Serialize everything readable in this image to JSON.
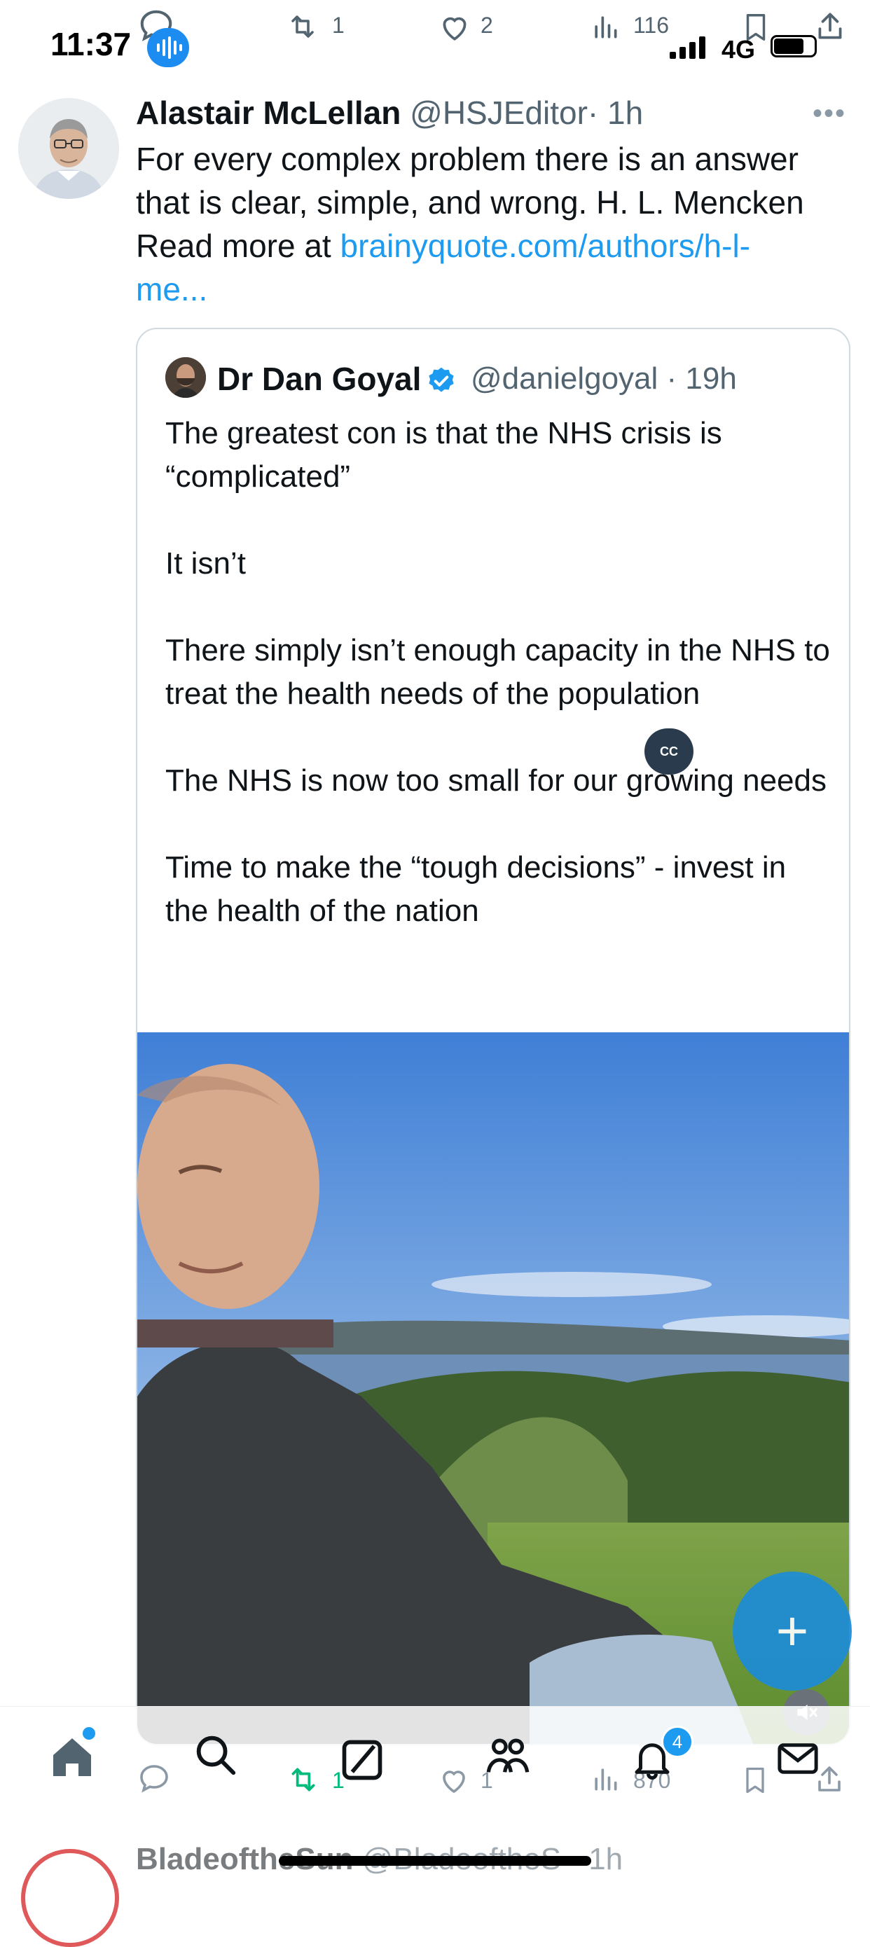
{
  "status_bar": {
    "time": "11:37",
    "network": "4G",
    "icons": [
      "mic-wave-icon",
      "signal-icon",
      "battery-icon"
    ]
  },
  "top_actions": {
    "retweets": "1",
    "likes": "2",
    "views": "116"
  },
  "tweet": {
    "author_name": "Alastair McLellan",
    "handle": "@HSJEditor",
    "time": "· 1h",
    "text": "For every complex problem there is an answer that is clear, simple, and wrong. H. L. Mencken",
    "link_prefix": "Read more at ",
    "link_line1": "brainyquote.com/authors/h-l-",
    "link_line2": "me..."
  },
  "quote": {
    "author_name": "Dr Dan Goyal",
    "handle": "@danielgoyal · 19h",
    "paragraphs": [
      "The greatest con is that the NHS crisis is “complicated”",
      "It isn’t",
      "There simply isn’t enough capacity in the NHS to treat the health needs of the population",
      "The NHS is now too small for our growing needs",
      "Time to make the “tough decisions” - invest in the health of the nation"
    ],
    "cc_label": "CC"
  },
  "bottom_actions": {
    "retweets": "1",
    "likes": "1",
    "views": "870"
  },
  "nav": {
    "notifications_badge": "4",
    "tabs": [
      "home-icon",
      "search-icon",
      "grok-icon",
      "communities-icon",
      "notifications-icon",
      "messages-icon"
    ]
  },
  "next_tweet": {
    "author_name": "BladeoftheSun",
    "handle": "@BladeoftheS · 1h"
  },
  "colors": {
    "accent": "#1d9bf0",
    "retweet_green": "#00ba7c",
    "secondary_text": "#536471"
  }
}
